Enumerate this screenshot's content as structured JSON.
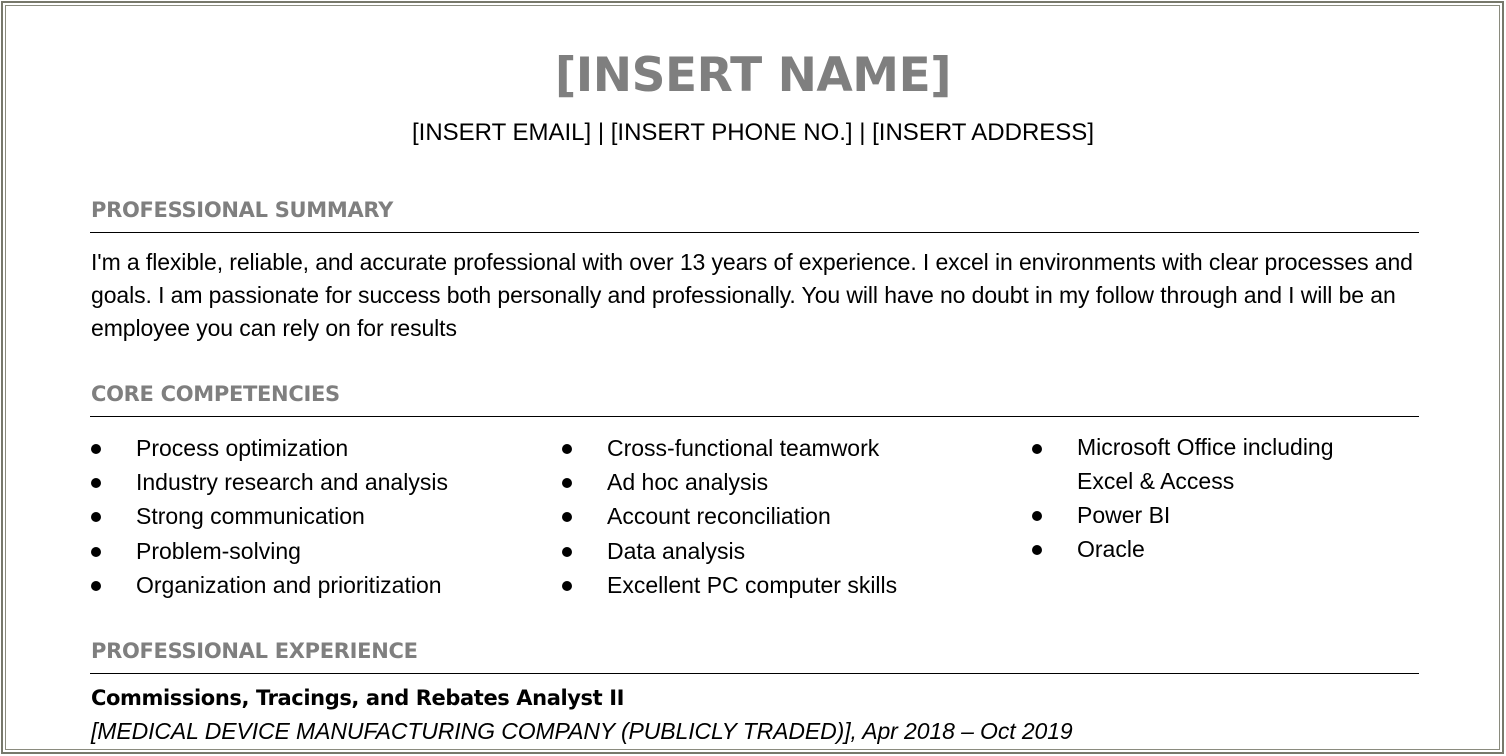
{
  "header": {
    "name": "[INSERT NAME]",
    "contact": "[INSERT EMAIL] | [INSERT PHONE NO.] | [INSERT ADDRESS]"
  },
  "sections": {
    "summary": {
      "title": "PROFESSIONAL SUMMARY",
      "text": "I'm a flexible, reliable, and accurate professional with over 13 years of experience. I excel in environments with clear processes and goals. I am passionate for success both personally and professionally. You will have no doubt in my follow through and I will be an employee you can rely on for results"
    },
    "competencies": {
      "title": "CORE COMPETENCIES",
      "columns": [
        [
          "Process optimization",
          "Industry research and analysis",
          "Strong communication",
          "Problem-solving",
          "Organization and prioritization"
        ],
        [
          "Cross-functional teamwork",
          "Ad hoc analysis",
          "Account reconciliation",
          "Data analysis",
          "Excellent PC computer skills"
        ],
        [
          "Microsoft Office including Excel & Access",
          "Power BI",
          "Oracle"
        ]
      ]
    },
    "experience": {
      "title": "PROFESSIONAL EXPERIENCE",
      "jobs": [
        {
          "title": "Commissions, Tracings, and Rebates Analyst II",
          "company_dates": "[MEDICAL DEVICE MANUFACTURING COMPANY (PUBLICLY TRADED)], Apr 2018 – Oct 2019"
        }
      ]
    }
  },
  "colors": {
    "heading_gray": "#7f7f7f",
    "border": "#77786b",
    "text": "#000000"
  }
}
